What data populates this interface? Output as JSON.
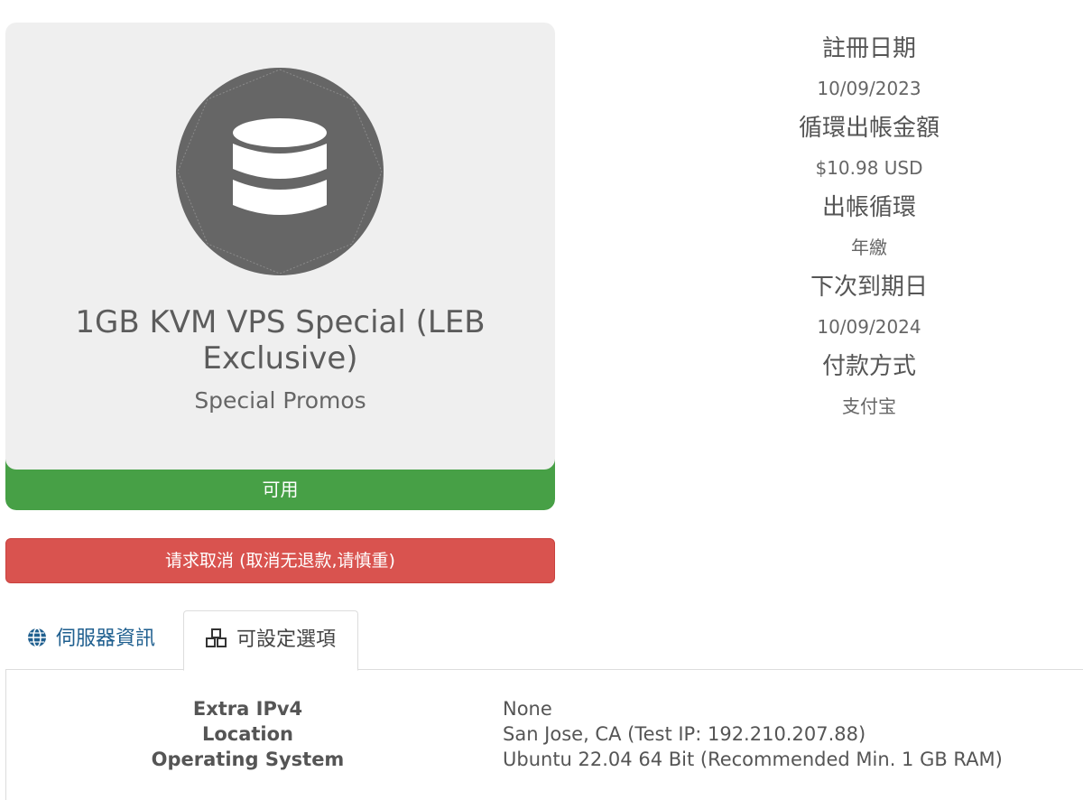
{
  "product": {
    "name": "1GB KVM VPS Special (LEB Exclusive)",
    "group": "Special Promos",
    "status": "可用",
    "icon": "database-icon"
  },
  "cancel_button": "请求取消 (取消无退款,请慎重)",
  "info": [
    {
      "label": "註冊日期",
      "value": "10/09/2023"
    },
    {
      "label": "循環出帳金額",
      "value": "$10.98 USD"
    },
    {
      "label": "出帳循環",
      "value": "年繳"
    },
    {
      "label": "下次到期日",
      "value": "10/09/2024"
    },
    {
      "label": "付款方式",
      "value": "支付宝"
    }
  ],
  "tabs": [
    {
      "label": "伺服器資訊",
      "icon": "globe-icon",
      "active": false
    },
    {
      "label": "可設定選項",
      "icon": "cubes-icon",
      "active": true
    }
  ],
  "config_options": [
    {
      "key": "Extra IPv4",
      "value": "None"
    },
    {
      "key": "Location",
      "value": "San Jose, CA (Test IP: 192.210.207.88)"
    },
    {
      "key": "Operating System",
      "value": "Ubuntu 22.04 64 Bit (Recommended Min. 1 GB RAM)"
    }
  ],
  "colors": {
    "status_green": "#47a046",
    "cancel_red": "#d9534f",
    "tab_link": "#1f5f8f"
  }
}
